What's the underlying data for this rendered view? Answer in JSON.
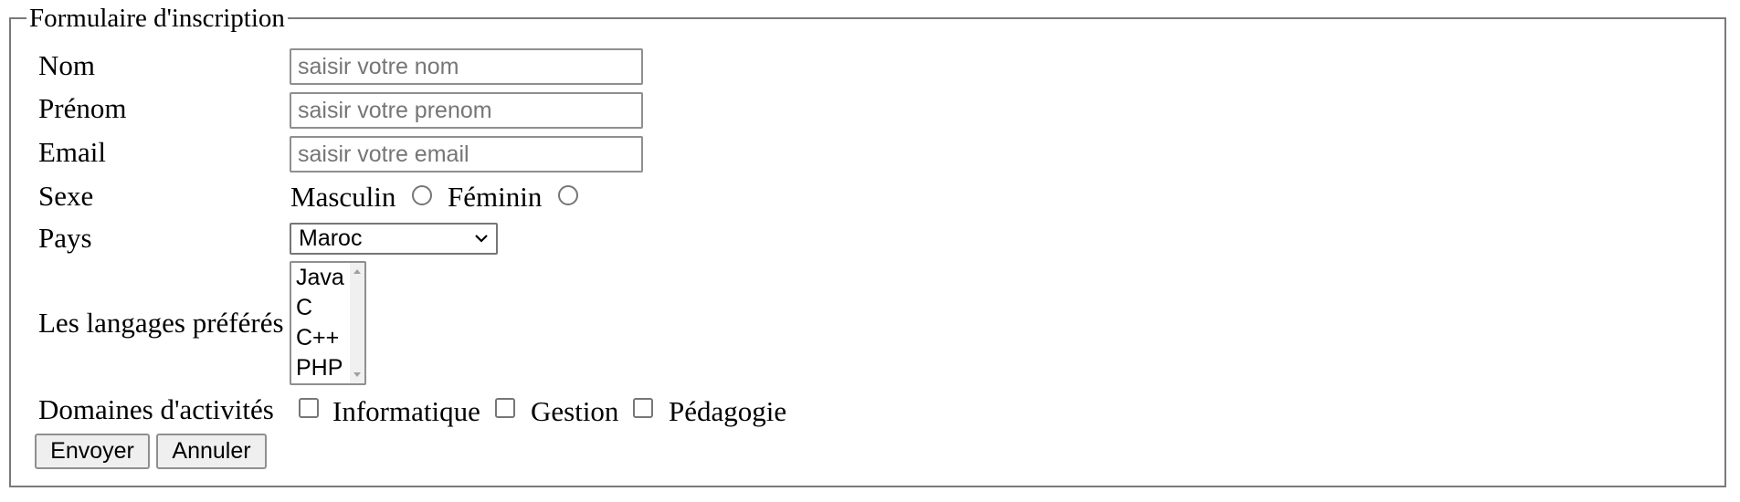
{
  "form": {
    "legend": "Formulaire d'inscription",
    "nom": {
      "label": "Nom",
      "placeholder": "saisir votre nom",
      "value": ""
    },
    "prenom": {
      "label": "Prénom",
      "placeholder": "saisir votre prenom",
      "value": ""
    },
    "email": {
      "label": "Email",
      "placeholder": "saisir votre email",
      "value": ""
    },
    "sexe": {
      "label": "Sexe",
      "options": [
        {
          "label": "Masculin",
          "checked": false
        },
        {
          "label": "Féminin",
          "checked": false
        }
      ]
    },
    "pays": {
      "label": "Pays",
      "selected": "Maroc",
      "icon": "chevron-down-icon"
    },
    "langages": {
      "label": "Les langages préférés",
      "options": [
        "Java",
        "C",
        "C++",
        "PHP"
      ]
    },
    "domaines": {
      "label": "Domaines d'activités",
      "options": [
        {
          "label": "Informatique",
          "checked": false
        },
        {
          "label": "Gestion",
          "checked": false
        },
        {
          "label": "Pédagogie",
          "checked": false
        }
      ]
    },
    "buttons": {
      "submit": "Envoyer",
      "reset": "Annuler"
    }
  },
  "colors": {
    "border": "#7a7a7a",
    "input_border": "#8f8f8f",
    "placeholder": "#767676",
    "button_bg": "#efefef"
  }
}
